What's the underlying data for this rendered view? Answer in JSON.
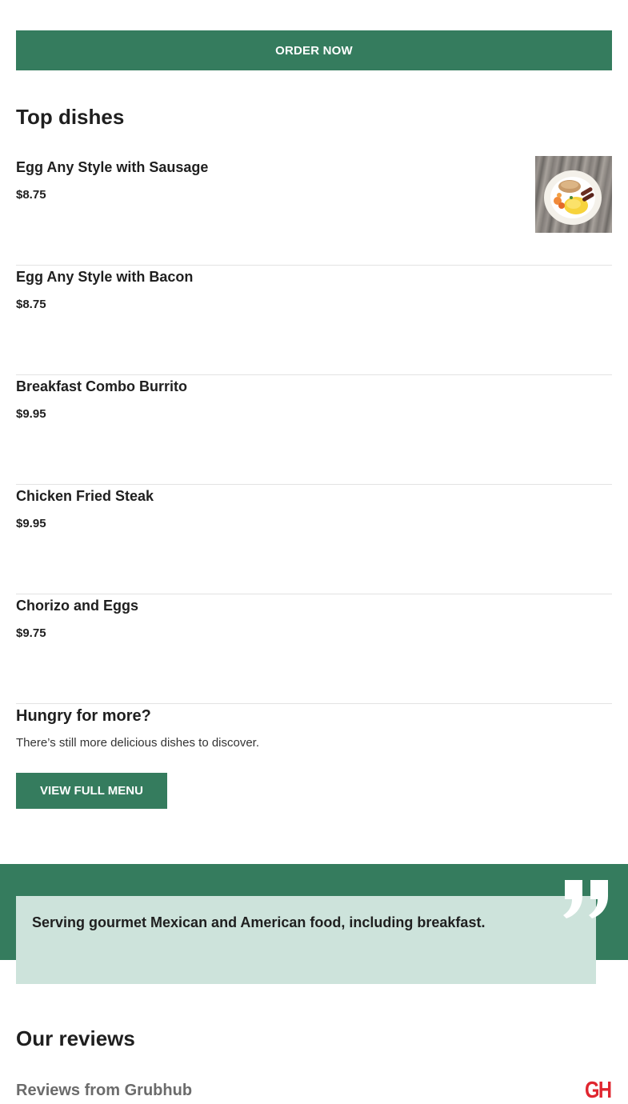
{
  "order_button": {
    "label": "ORDER NOW"
  },
  "top_dishes": {
    "title": "Top dishes",
    "items": [
      {
        "name": "Egg Any Style with Sausage",
        "price": "$8.75",
        "has_image": true
      },
      {
        "name": "Egg Any Style with Bacon",
        "price": "$8.75",
        "has_image": false
      },
      {
        "name": "Breakfast Combo Burrito",
        "price": "$9.95",
        "has_image": false
      },
      {
        "name": "Chicken Fried Steak",
        "price": "$9.95",
        "has_image": false
      },
      {
        "name": "Chorizo and Eggs",
        "price": "$9.75",
        "has_image": false
      }
    ]
  },
  "hungry": {
    "title": "Hungry for more?",
    "text": "There’s still more delicious dishes to discover.",
    "button_label": "VIEW FULL MENU"
  },
  "about": {
    "text": "Serving gourmet Mexican and American food, including breakfast.",
    "icon": "quote-icon"
  },
  "reviews": {
    "title": "Our reviews",
    "subtitle": "Reviews from Grubhub",
    "logo_text": "GH"
  },
  "colors": {
    "brand_green": "#357c5e",
    "card_mint": "#cde3db",
    "grubhub_red": "#e0262f"
  }
}
